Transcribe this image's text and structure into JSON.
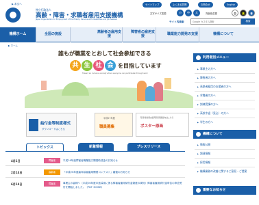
{
  "header": {
    "skip_link": "▶ 本文へ",
    "org_small": "独立行政法人",
    "org_name": "高齢・障害・求職者雇用支援機構",
    "org_en": "Japan Organization for Employment of the Elderly, Persons with Disabilities and Job Seekers",
    "top_links": [
      "サイトマップ",
      "よくある質問",
      "お問合せ",
      "English"
    ],
    "size_label": "文字サイズ変更",
    "size_buttons": [
      "小",
      "中",
      "大"
    ],
    "color_label": "背景色変更",
    "color_buttons": [
      "白",
      "黒",
      "青"
    ],
    "search_label": "サイト内検索",
    "search_placeholder": "Google カスタム検索",
    "search_button": "検索"
  },
  "nav": [
    {
      "label": "機構ホーム",
      "active": true
    },
    {
      "label": "全国の施設",
      "active": false
    },
    {
      "label": "高齢者の雇用支援",
      "active": false
    },
    {
      "label": "障害者の雇用支援",
      "active": false
    },
    {
      "label": "職業能力開発の支援",
      "active": false
    },
    {
      "label": "機構について",
      "active": false
    }
  ],
  "breadcrumb": "▶ ホーム",
  "hero": {
    "line1": "誰もが職業をとおして社会参加できる",
    "chars": [
      "共",
      "生",
      "社",
      "会"
    ],
    "char_colors": [
      "#f4a51c",
      "#8cc63f",
      "#e8577a",
      "#3aa0d8"
    ],
    "line2": "を目指しています",
    "en": "Toward an inclusive society where everyone can participate through work"
  },
  "banners": [
    {
      "title": "給付金等制度様式",
      "sub": "ダウンロードはこちら"
    },
    {
      "title": "職員募集",
      "sub": "平成27年度"
    },
    {
      "title": "ポスター原画",
      "sub": "障害者雇用支援月間 募集案内はこちら"
    }
  ],
  "tabs": [
    {
      "label": "トピックス",
      "active": true
    },
    {
      "label": "新着情報",
      "active": false
    },
    {
      "label": "プレスリリース",
      "active": false
    }
  ],
  "news": [
    {
      "date": "4月1日",
      "tag": "障害者",
      "tag_color": "#e45a8a",
      "text": "平成26年度障害者職業能力開発助成金のお知らせ"
    },
    {
      "date": "2月14日",
      "tag": "高齢者",
      "tag_color": "#f39800",
      "text": "「平成26年度高年齢者雇用開発コンテスト」審査のお知らせ"
    },
    {
      "date": "6月14日",
      "tag": "障害者",
      "tag_color": "#e45a8a",
      "text": "事業主の皆様へ（平成26年度中途採用に係る障害者雇用納付金制度の周知）障害者雇用納付金申告の申告受付を開始しました。（PDF 300KB）"
    }
  ],
  "side": {
    "section1_title": "利用者別メニュー",
    "section1_items": [
      "事業主の方へ",
      "障害者の方へ",
      "高齢者雇用の支援者の方へ",
      "求職者の方へ",
      "訓練受講の方へ",
      "高校中退（見込）の方へ",
      "学生の方へ"
    ],
    "section2_title": "機構について",
    "section2_items": [
      "情報公開",
      "調達情報",
      "採用情報",
      "機構業務の改善に関するご意見・ご提案"
    ],
    "section3_title": "重要なお知らせ"
  },
  "colors": {
    "brand": "#1b5fa8",
    "nav_bg": "#e6eef8"
  }
}
